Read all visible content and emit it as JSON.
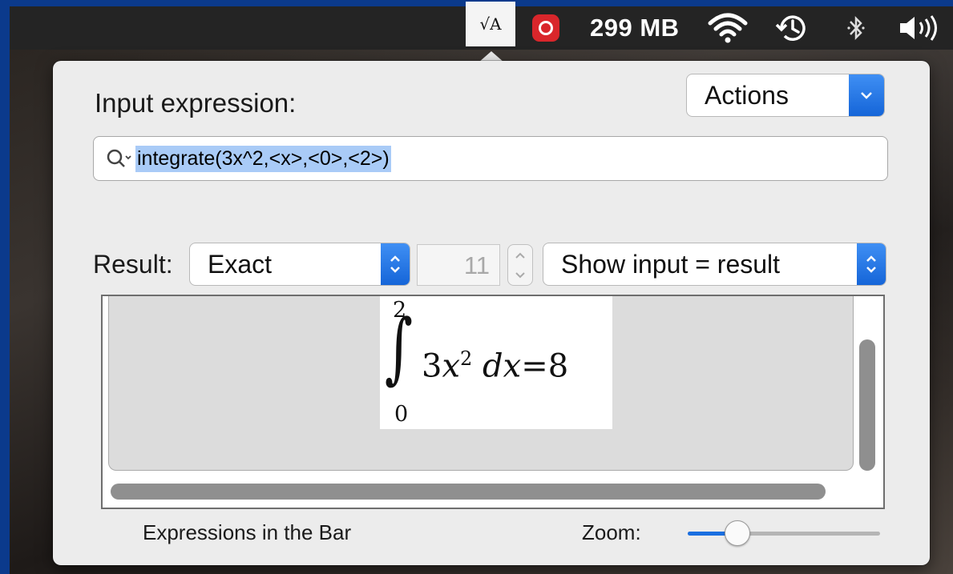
{
  "menubar": {
    "calc_icon": "√A",
    "record_icon": "record-button-icon",
    "memory_text": "299 MB",
    "icons": [
      "wifi-icon",
      "time-machine-icon",
      "bluetooth-icon",
      "volume-icon"
    ]
  },
  "panel": {
    "input_label": "Input expression:",
    "actions_label": "Actions",
    "search_value": "integrate(3x^2,<x>,<0>,<2>)",
    "result_label": "Result:",
    "mode_value": "Exact",
    "digits_value": "11",
    "format_value": "Show input = result",
    "formula": {
      "upper": "2",
      "lower": "0",
      "integral": "∫",
      "coef": "3",
      "var": "x",
      "power": "2",
      "d": "d",
      "dvar": "x",
      "eq": "=",
      "result": "8"
    },
    "bar_label": "Expressions in the Bar",
    "zoom_label": "Zoom:",
    "zoom_level": 0.26
  },
  "colors": {
    "accent": "#1a6fe0",
    "record": "#d9262b"
  }
}
